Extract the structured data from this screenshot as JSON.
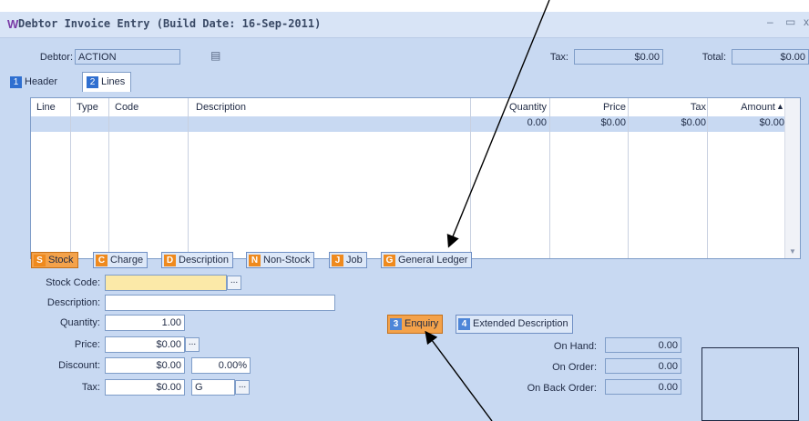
{
  "window": {
    "title": "Debtor Invoice Entry (Build Date: 16-Sep-2011)",
    "logo": "W",
    "minimize": "–",
    "maximize": "▭",
    "close": "x"
  },
  "header": {
    "debtor_label": "Debtor:",
    "debtor_value": "ACTION",
    "tax_label": "Tax:",
    "tax_value": "$0.00",
    "total_label": "Total:",
    "total_value": "$0.00"
  },
  "tabs": [
    {
      "num": "1",
      "label": "Header"
    },
    {
      "num": "2",
      "label": "Lines"
    }
  ],
  "grid": {
    "columns": [
      "Line",
      "Type",
      "Code",
      "Description",
      "Quantity",
      "Price",
      "Tax",
      "Amount"
    ],
    "row": {
      "quantity": "0.00",
      "price": "$0.00",
      "tax": "$0.00",
      "amount": "$0.00"
    }
  },
  "line_types": [
    {
      "key": "S",
      "label": "Stock"
    },
    {
      "key": "C",
      "label": "Charge"
    },
    {
      "key": "D",
      "label": "Description"
    },
    {
      "key": "N",
      "label": "Non-Stock"
    },
    {
      "key": "J",
      "label": "Job"
    },
    {
      "key": "G",
      "label": "General Ledger"
    }
  ],
  "form": {
    "stock_code_label": "Stock Code:",
    "stock_code_value": "",
    "ellipsis": "...",
    "description_label": "Description:",
    "description_value": "",
    "quantity_label": "Quantity:",
    "quantity_value": "1.00",
    "price_label": "Price:",
    "price_value": "$0.00",
    "discount_label": "Discount:",
    "discount_value": "$0.00",
    "discount_pct": "0.00%",
    "tax_label": "Tax:",
    "tax_value": "$0.00",
    "tax_code": "G"
  },
  "sub_buttons": [
    {
      "key": "3",
      "label": "Enquiry"
    },
    {
      "key": "4",
      "label": "Extended Description"
    }
  ],
  "stock_info": {
    "on_hand_label": "On Hand:",
    "on_hand_value": "0.00",
    "on_order_label": "On Order:",
    "on_order_value": "0.00",
    "on_back_order_label": "On Back Order:",
    "on_back_order_value": "0.00"
  }
}
